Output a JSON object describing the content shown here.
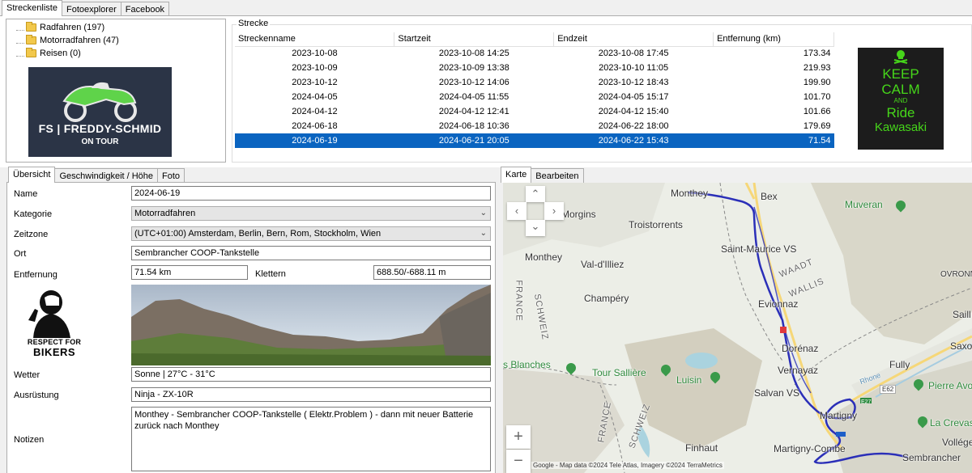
{
  "top_tabs": [
    "Streckenliste",
    "Fotoexplorer",
    "Facebook"
  ],
  "tree": [
    {
      "label": "Radfahren (197)"
    },
    {
      "label": "Motorradfahren (47)"
    },
    {
      "label": "Reisen (0)"
    }
  ],
  "logo": {
    "line1": "FS | FREDDY-SCHMID",
    "line2": "ON TOUR",
    "bg": "#2b3446",
    "accent": "#5fd34a"
  },
  "strecke": {
    "group_title": "Strecke",
    "columns": [
      "Streckenname",
      "Startzeit",
      "Endzeit",
      "Entfernung (km)"
    ],
    "rows": [
      [
        "2023-10-08",
        "2023-10-08 14:25",
        "2023-10-08 17:45",
        "173.34"
      ],
      [
        "2023-10-09",
        "2023-10-09 13:38",
        "2023-10-10 11:05",
        "219.93"
      ],
      [
        "2023-10-12",
        "2023-10-12 14:06",
        "2023-10-12 18:43",
        "199.90"
      ],
      [
        "2024-04-05",
        "2024-04-05 11:55",
        "2024-04-05 15:17",
        "101.70"
      ],
      [
        "2024-04-12",
        "2024-04-12 12:41",
        "2024-04-12 15:40",
        "101.66"
      ],
      [
        "2024-06-18",
        "2024-06-18 10:36",
        "2024-06-22 18:00",
        "179.69"
      ],
      [
        "2024-06-19",
        "2024-06-21 20:05",
        "2024-06-22 15:43",
        "71.54"
      ]
    ],
    "selected_row_index": 6,
    "selection_color": "#0a64c0"
  },
  "keep_calm": {
    "lines": [
      "KEEP",
      "CALM",
      "AND",
      "Ride",
      "Kawasaki"
    ],
    "bg": "#1c1c1c",
    "fg": "#46d61a"
  },
  "detail_tabs": [
    "Übersicht",
    "Geschwindigkeit / Höhe",
    "Foto"
  ],
  "form": {
    "name_label": "Name",
    "name_value": "2024-06-19",
    "kategorie_label": "Kategorie",
    "kategorie_value": "Motorradfahren",
    "zeitzone_label": "Zeitzone",
    "zeitzone_value": "(UTC+01:00) Amsterdam, Berlin, Bern, Rom, Stockholm, Wien",
    "ort_label": "Ort",
    "ort_value": "Sembrancher COOP-Tankstelle",
    "entfernung_label": "Entfernung",
    "entfernung_value": "71.54 km",
    "klettern_label": "Klettern",
    "klettern_value": "688.50/-688.11 m",
    "wetter_label": "Wetter",
    "wetter_value": "Sonne | 27°C - 31°C",
    "ausruestung_label": "Ausrüstung",
    "ausruestung_value": "Ninja - ZX-10R",
    "notizen_label": "Notizen",
    "notizen_value": "Monthey - Sembrancher COOP-Tankstelle ( Elektr.Problem ) - dann mit neuer Batterie zurück nach Monthey"
  },
  "respect": {
    "line1": "RESPECT FOR",
    "line2": "BIKERS"
  },
  "map_tabs": [
    "Karte",
    "Bearbeiten"
  ],
  "map": {
    "labels": {
      "monthey_top": "Monthey",
      "bex": "Bex",
      "morgins": "Morgins",
      "troistorrents": "Troistorrents",
      "muveran": "Muveran",
      "saint_maurice": "Saint-Maurice VS",
      "val_dilliez": "Val-d'Illiez",
      "monthey_mid": "Monthey",
      "waadt": "WAADT",
      "wallis": "WALLIS",
      "ovronnaz": "OVRONNAZ",
      "champery": "Champéry",
      "evionnaz": "Evionnaz",
      "saill": "Saill",
      "france1": "FRANCE",
      "schweiz1": "SCHWEIZ",
      "dorenaz": "Dorénaz",
      "saxon": "Saxon V",
      "blanches": "s Blanches",
      "tour_salliere": "Tour Sallière",
      "luisin": "Luisin",
      "vernayaz": "Vernayaz",
      "fully": "Fully",
      "rhone": "Rhone",
      "pierre_avo": "Pierre Avo",
      "salvan": "Salvan VS",
      "e62": "E62",
      "e27": "E27",
      "martigny": "Martigny",
      "la_crevasse": "La Crevass",
      "france2": "FRANCE",
      "schweiz2": "SCHWEIZ",
      "finhaut": "Finhaut",
      "martigny_combe": "Martigny-Combe",
      "volleges": "Volléges",
      "sembrancher": "Sembrancher"
    },
    "attribution": "Google - Map data ©2024 Tele Atlas, Imagery ©2024 TerraMetrics",
    "zoom_in": "+",
    "zoom_out": "−",
    "route_color": "#2b2fb8"
  }
}
